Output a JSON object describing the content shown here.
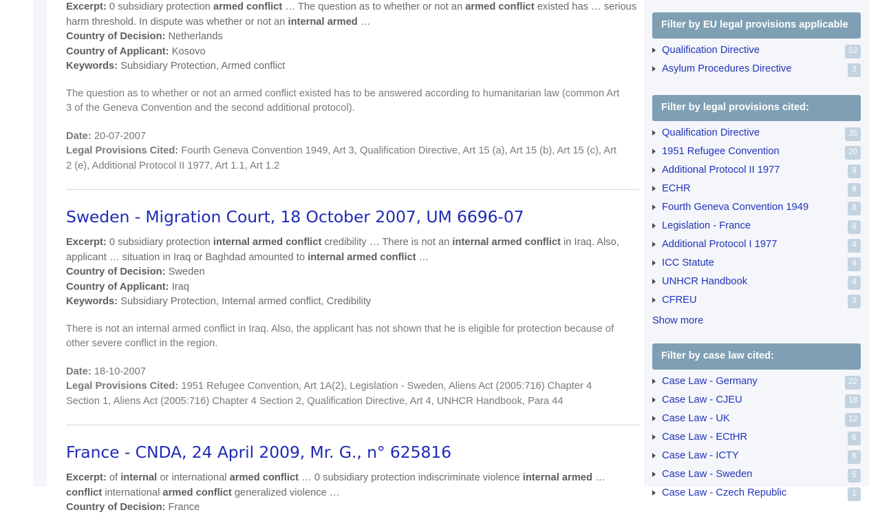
{
  "results": [
    {
      "title": null,
      "excerpt_label": "Excerpt:",
      "excerpt_parts": [
        {
          "t": "0 subsidiary protection ",
          "b": false
        },
        {
          "t": "armed conflict",
          "b": true
        },
        {
          "t": " … The question as to whether or not an ",
          "b": false
        },
        {
          "t": "armed conflict",
          "b": true
        },
        {
          "t": " existed has … serious harm threshold. In dispute was whether or not an ",
          "b": false
        },
        {
          "t": "internal armed",
          "b": true
        },
        {
          "t": " …",
          "b": false
        }
      ],
      "country_decision_label": "Country of Decision:",
      "country_decision": "Netherlands",
      "country_applicant_label": "Country of Applicant:",
      "country_applicant": "Kosovo",
      "keywords_label": "Keywords:",
      "keywords": "Subsidiary Protection, Armed conflict",
      "summary": "The question as to whether or not an armed conflict existed has to be answered according to humanitarian law (common Art 3 of the Geneva Convention and the second additional protocol).",
      "date_label": "Date:",
      "date": "20-07-2007",
      "provisions_label": "Legal Provisions Cited:",
      "provisions": "Fourth Geneva Convention 1949, Art 3, Qualification Directive, Art 15 (a), Art 15 (b), Art 15 (c), Art 2 (e), Additional Protocol II 1977, Art 1.1, Art 1.2"
    },
    {
      "title": "Sweden - Migration Court, 18 October 2007, UM 6696-07",
      "excerpt_label": "Excerpt:",
      "excerpt_parts": [
        {
          "t": "0 subsidiary protection ",
          "b": false
        },
        {
          "t": "internal armed conflict",
          "b": true
        },
        {
          "t": " credibility … There is not an ",
          "b": false
        },
        {
          "t": "internal armed conflict",
          "b": true
        },
        {
          "t": " in Iraq. Also, applicant … situation in Iraq or Baghdad amounted to ",
          "b": false
        },
        {
          "t": "internal armed conflict",
          "b": true
        },
        {
          "t": " …",
          "b": false
        }
      ],
      "country_decision_label": "Country of Decision:",
      "country_decision": "Sweden",
      "country_applicant_label": "Country of Applicant:",
      "country_applicant": "Iraq",
      "keywords_label": "Keywords:",
      "keywords": "Subsidiary Protection, Internal armed conflict, Credibility",
      "summary": "There is not an internal armed conflict in Iraq. Also, the applicant has not shown that he is eligible for protection because of other severe conflict in the region.",
      "date_label": "Date:",
      "date": "18-10-2007",
      "provisions_label": "Legal Provisions Cited:",
      "provisions": "1951 Refugee Convention, Art 1A(2), Legislation - Sweden, Aliens Act (2005:716) Chapter 4 Section 1, Aliens Act (2005:716) Chapter 4 Section 2, Qualification Directive, Art 4, UNHCR Handbook, Para 44"
    },
    {
      "title": "France - CNDA, 24 April 2009, Mr. G., n° 625816",
      "excerpt_label": "Excerpt:",
      "excerpt_parts": [
        {
          "t": "of ",
          "b": false
        },
        {
          "t": "internal",
          "b": true
        },
        {
          "t": " or international ",
          "b": false
        },
        {
          "t": "armed conflict",
          "b": true
        },
        {
          "t": " … 0 subsidiary protection indiscriminate violence ",
          "b": false
        },
        {
          "t": "internal armed",
          "b": true
        },
        {
          "t": " … ",
          "b": false
        },
        {
          "t": "conflict",
          "b": true
        },
        {
          "t": " international ",
          "b": false
        },
        {
          "t": "armed conflict",
          "b": true
        },
        {
          "t": " generalized violence …",
          "b": false
        }
      ],
      "country_decision_label": "Country of Decision:",
      "country_decision": "France",
      "country_applicant_label": null,
      "country_applicant": null,
      "keywords_label": null,
      "keywords": null,
      "summary": null,
      "date_label": null,
      "date": null,
      "provisions_label": null,
      "provisions": null
    }
  ],
  "sidebar": {
    "facets": [
      {
        "title": "Filter by EU legal provisions applicable",
        "items": [
          {
            "label": "Qualification Directive",
            "count": "52"
          },
          {
            "label": "Asylum Procedures Directive",
            "count": "3"
          }
        ],
        "show_more": null
      },
      {
        "title": "Filter by legal provisions cited:",
        "items": [
          {
            "label": "Qualification Directive",
            "count": "35"
          },
          {
            "label": "1951 Refugee Convention",
            "count": "20"
          },
          {
            "label": "Additional Protocol II 1977",
            "count": "9"
          },
          {
            "label": "ECHR",
            "count": "9"
          },
          {
            "label": "Fourth Geneva Convention 1949",
            "count": "8"
          },
          {
            "label": "Legislation - France",
            "count": "8"
          },
          {
            "label": "Additional Protocol I 1977",
            "count": "4"
          },
          {
            "label": "ICC Statute",
            "count": "4"
          },
          {
            "label": "UNHCR Handbook",
            "count": "4"
          },
          {
            "label": "CFREU",
            "count": "3"
          }
        ],
        "show_more": "Show more"
      },
      {
        "title": "Filter by case law cited:",
        "items": [
          {
            "label": "Case Law - Germany",
            "count": "22"
          },
          {
            "label": "Case Law - CJEU",
            "count": "18"
          },
          {
            "label": "Case Law - UK",
            "count": "12"
          },
          {
            "label": "Case Law - ECtHR",
            "count": "6"
          },
          {
            "label": "Case Law - ICTY",
            "count": "6"
          },
          {
            "label": "Case Law - Sweden",
            "count": "5"
          },
          {
            "label": "Case Law - Czech Republic",
            "count": "1"
          }
        ],
        "show_more": null
      }
    ]
  },
  "colors": {
    "facet_header_bg": "#7fa0b4",
    "sidebar_bg": "#f4f6fa",
    "link": "#2233b8",
    "title_link": "#1f2bb5",
    "badge_bg": "#c3d3e0",
    "divider": "#d9d9d9",
    "body_text": "#7a7a7a"
  }
}
